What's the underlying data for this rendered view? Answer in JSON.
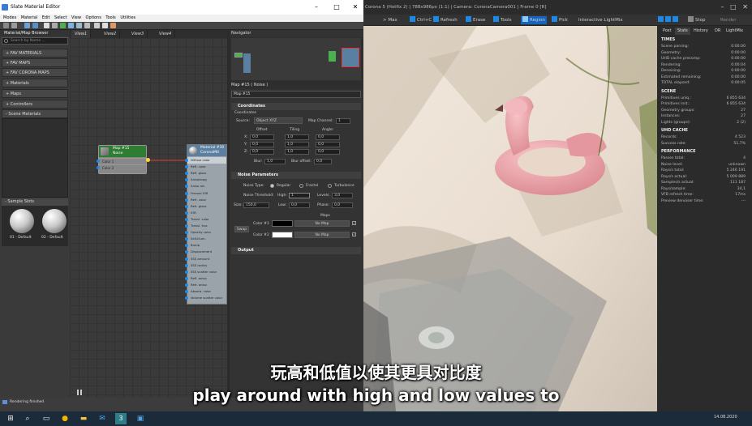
{
  "sme": {
    "title": "Slate Material Editor",
    "menu": [
      "Modes",
      "Material",
      "Edit",
      "Select",
      "View",
      "Options",
      "Tools",
      "Utilities"
    ],
    "view_selector": "View1",
    "browser": {
      "title": "Material/Map Browser",
      "search_placeholder": "Search by Name ...",
      "libraries": [
        "+ FAV MATERIALS",
        "+ FAV MAPS",
        "+ FAV CORONA MAPS",
        "+ Materials",
        "+ Maps",
        "+ Controllers",
        "- Scene Materials"
      ],
      "sample_slots_title": "- Sample Slots",
      "slots": [
        "01 - Default",
        "02 - Default"
      ]
    },
    "view_tabs": [
      "View1",
      "View2",
      "View3",
      "View4"
    ],
    "noise_node": {
      "title": "Map #15",
      "subtitle": "Noise",
      "rows": [
        "Color 1",
        "Color 2"
      ]
    },
    "material_node": {
      "title": "Material #30",
      "subtitle": "CoronaMtl",
      "rows": [
        "Diffuse color",
        "Refl. color",
        "Refl. gloss",
        "Anisotropy",
        "Aniso rot.",
        "Fresnel IOR",
        "Refr. color",
        "Refr. gloss",
        "IOR",
        "Transl. color",
        "Transl. frac",
        "Opacity color",
        "Self-illum.",
        "Bump",
        "Displacement",
        "SSS amount",
        "SSS radius",
        "SSS scatter color",
        "Refl. aniso",
        "Refr. aniso",
        "Absorb. color",
        "Volume scatter color"
      ]
    },
    "navigator_title": "Navigator",
    "params": {
      "title": "Map #15  ( Noise )",
      "name": "Map #15",
      "coordinates": {
        "title": "Coordinates",
        "group": "Coordinates",
        "source_label": "Source:",
        "source_value": "Object XYZ",
        "map_channel_label": "Map Channel:",
        "map_channel_value": "1",
        "offset_label": "Offset",
        "tiling_label": "Tiling",
        "angle_label": "Angle:",
        "axes": [
          "X:",
          "Y:",
          "Z:"
        ],
        "offset": [
          "0,0",
          "0,0",
          "0,0"
        ],
        "tiling": [
          "1,0",
          "1,0",
          "1,0"
        ],
        "angle": [
          "0,0",
          "0,0",
          "0,0"
        ],
        "blur_label": "Blur:",
        "blur": "1,0",
        "blur_offset_label": "Blur offset:",
        "blur_offset": "0,0"
      },
      "noise": {
        "title": "Noise Parameters",
        "type_label": "Noise Type:",
        "types": [
          "Regular",
          "Fractal",
          "Turbulence"
        ],
        "selected_type": "Regular",
        "threshold_label": "Noise Threshold:",
        "high_label": "High:",
        "high": "1",
        "levels_label": "Levels:",
        "levels": "3,0",
        "size_label": "Size:",
        "size": "150,0",
        "low_label": "Low:",
        "low": "0,0",
        "phase_label": "Phase:",
        "phase": "0,0",
        "maps_label": "Maps",
        "swap_label": "Swap",
        "color1_label": "Color #1",
        "color2_label": "Color #2",
        "color1": "#000000",
        "color2": "#ffffff",
        "no_map": "No Map"
      },
      "output_title": "Output"
    },
    "status": "Rendering finished"
  },
  "render": {
    "title": "Corona 5 (Hotfix 2) | 788x986px (1:1) | Camera: CoronaCamera001 | Frame 0 [R]",
    "toolbar": [
      "Max",
      "Ctrl+C",
      "Refresh",
      "Erase",
      "Tools",
      "Region",
      "Pick",
      "Interactive LightMix"
    ],
    "stop_label": "Stop",
    "render_label": "Render",
    "stat_tabs": [
      "Post",
      "Stats",
      "History",
      "DR",
      "LightMix"
    ],
    "active_tab": "Stats",
    "sections": [
      {
        "title": "TIMES",
        "rows": [
          [
            "Scene parsing:",
            "0:00:00"
          ],
          [
            "Geometry:",
            "0:00:00"
          ],
          [
            "UHD cache precomp:",
            "0:00:00"
          ],
          [
            "Rendering:",
            "0:00:04"
          ],
          [
            "Denoising:",
            "0:00:00"
          ],
          [
            "Estimated remaining:",
            "0:00:00"
          ],
          [
            "TOTAL elapsed:",
            "0:00:05"
          ]
        ]
      },
      {
        "title": "SCENE",
        "rows": [
          [
            "Primitives uniq.:",
            "6 855 634"
          ],
          [
            "Primitives inst.:",
            "6 855 634"
          ],
          [
            "Geometry groups:",
            "27"
          ],
          [
            "Instances:",
            "27"
          ],
          [
            "Lights (groups):",
            "2 (2)"
          ]
        ]
      },
      {
        "title": "UHD CACHE",
        "rows": [
          [
            "Records:",
            "4 523"
          ],
          [
            "Success rate:",
            "51,7%"
          ]
        ]
      },
      {
        "title": "PERFORMANCE",
        "rows": [
          [
            "Passes total:",
            "4"
          ],
          [
            "Noise level:",
            "unknown"
          ],
          [
            "Rays/s total:",
            "5 246 191"
          ],
          [
            "Rays/s actual:",
            "5 009 889"
          ],
          [
            "Samples/s actual:",
            "111 187"
          ],
          [
            "Rays/sample:",
            "34,1"
          ],
          [
            "VFB refresh time:",
            "17ms"
          ],
          [
            "Preview denoiser time:",
            "---"
          ]
        ]
      }
    ]
  },
  "subtitles": {
    "zh": "玩高和低值以使其更具对比度",
    "en": "play around with high and low values to"
  },
  "taskbar": {
    "date": "14.08.2020"
  }
}
